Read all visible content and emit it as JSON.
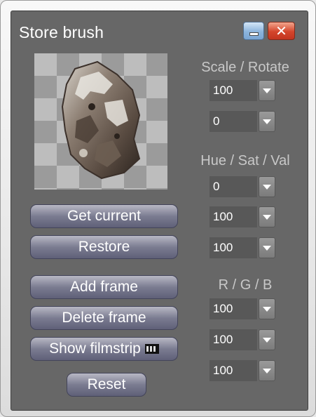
{
  "window": {
    "title": "Store brush",
    "minimize_icon": "minimize-icon",
    "close_icon": "close-icon",
    "close_glyph": "✕"
  },
  "preview": {
    "icon": "brush-preview-image"
  },
  "scale_rotate": {
    "label": "Scale / Rotate",
    "scale": "100",
    "rotate": "0"
  },
  "hue_sat_val": {
    "label": "Hue / Sat / Val",
    "hue": "0",
    "sat": "100",
    "val": "100"
  },
  "rgb": {
    "label": "R / G / B",
    "r": "100",
    "g": "100",
    "b": "100"
  },
  "buttons": {
    "get_current": "Get current",
    "restore": "Restore",
    "add_frame": "Add frame",
    "delete_frame": "Delete frame",
    "show_filmstrip": "Show filmstrip",
    "filmstrip_icon": "filmstrip-icon",
    "reset": "Reset"
  },
  "colors": {
    "panel": "#676767",
    "button": "#6e6f86",
    "close_red": "#d4452b",
    "minimize_blue": "#8cb4dc"
  }
}
